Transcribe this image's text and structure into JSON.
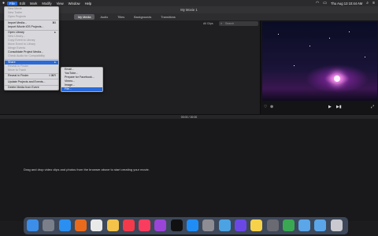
{
  "menubar": {
    "apple_icon": "apple-icon",
    "items": [
      "File",
      "Edit",
      "Mark",
      "Modify",
      "View",
      "Window",
      "Help"
    ],
    "clock": "Thu Aug 13  10:44 AM"
  },
  "window": {
    "title": "My Movie 1"
  },
  "toolbar": {
    "tabs": [
      "My Media",
      "Audio",
      "Titles",
      "Backgrounds",
      "Transitions"
    ],
    "selected_tab": "My Media"
  },
  "browser": {
    "clips_label": "All Clips",
    "search_placeholder": "Search"
  },
  "viewer": {
    "controls": [
      "heart-icon",
      "reject-icon",
      "play-icon",
      "skip-icon",
      "fullscreen-icon"
    ]
  },
  "timeline": {
    "timecode": "00:00  /  00:00",
    "empty_message": "Drag and drop video clips and photos from the browser above to start creating your movie."
  },
  "file_menu": {
    "items": [
      {
        "label": "New Movie",
        "disabled": true
      },
      {
        "label": "New Trailer",
        "disabled": true
      },
      {
        "label": "Open Projects",
        "disabled": true
      },
      {
        "sep": true
      },
      {
        "label": "Import Media...",
        "shortcut": "⌘I"
      },
      {
        "label": "Import iMovie iOS Projects..."
      },
      {
        "sep": true
      },
      {
        "label": "Open Library",
        "arrow": true
      },
      {
        "label": "New Library...",
        "disabled": true
      },
      {
        "label": "Copy Event to Library",
        "disabled": true
      },
      {
        "label": "Move Event to Library",
        "disabled": true
      },
      {
        "label": "Merge Events",
        "disabled": true
      },
      {
        "label": "Consolidate Project Media..."
      },
      {
        "label": "Check Audio for Compatibility",
        "disabled": true
      },
      {
        "sep": true
      },
      {
        "label": "Share",
        "arrow": true,
        "highlight": true
      },
      {
        "label": "Reveal in Finder",
        "disabled": true
      },
      {
        "label": "Move to Trash",
        "disabled": true
      },
      {
        "sep": true
      },
      {
        "label": "Reveal in Finder",
        "shortcut": "⇧⌘R"
      },
      {
        "sep": true
      },
      {
        "label": "Update Projects and Events..."
      },
      {
        "sep": true
      },
      {
        "label": "Delete Media from Event"
      }
    ]
  },
  "share_menu": {
    "items": [
      {
        "label": "Email..."
      },
      {
        "label": "YouTube..."
      },
      {
        "label": "Prepare for Facebook..."
      },
      {
        "label": "Vimeo..."
      },
      {
        "label": "Image..."
      },
      {
        "label": "File...",
        "highlight": true
      }
    ]
  },
  "dock": {
    "apps": [
      {
        "icon": "finder-icon",
        "color": "#3c8ee8"
      },
      {
        "icon": "launchpad-icon",
        "color": "#7a7f8a"
      },
      {
        "icon": "safari-icon",
        "color": "#2a8ff0"
      },
      {
        "icon": "firefox-icon",
        "color": "#e86a1c"
      },
      {
        "icon": "chrome-icon",
        "color": "#e9e9e9"
      },
      {
        "icon": "photos-icon",
        "color": "#f3c34a"
      },
      {
        "icon": "news-icon",
        "color": "#f23a4a"
      },
      {
        "icon": "music-icon",
        "color": "#fa3d5e"
      },
      {
        "icon": "podcasts-icon",
        "color": "#9a44d8"
      },
      {
        "icon": "tv-icon",
        "color": "#111111"
      },
      {
        "icon": "app-store-icon",
        "color": "#1f8df5"
      },
      {
        "icon": "settings-icon",
        "color": "#8d8d93"
      },
      {
        "icon": "preview-icon",
        "color": "#4ba3e3"
      },
      {
        "icon": "imovie-icon",
        "color": "#6a48e6"
      },
      {
        "icon": "notes-icon",
        "color": "#f6d24a"
      },
      {
        "icon": "screenshot-icon",
        "color": "#6a6a72"
      },
      {
        "icon": "activity-icon",
        "color": "#3aa752"
      },
      {
        "icon": "folder-icon",
        "color": "#5aa6e8"
      },
      {
        "icon": "folder-icon",
        "color": "#5aa6e8"
      },
      {
        "icon": "trash-icon",
        "color": "#c9c9cf"
      }
    ]
  }
}
